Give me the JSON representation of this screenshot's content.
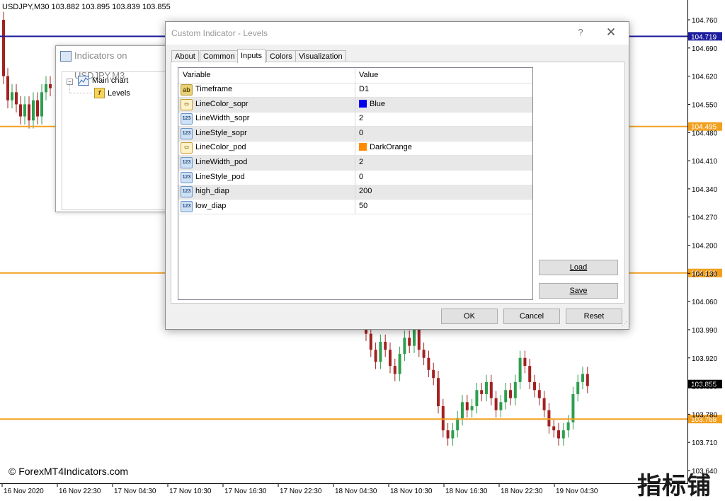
{
  "chart": {
    "header": "USDJPY,M30  103.882 103.895 103.839 103.855",
    "watermark": "© ForexMT4Indicators.com",
    "brand": "指标铺",
    "colors": {
      "bull": "#2e9e4f",
      "bear": "#a32121",
      "blue_line": "#1c1c9c",
      "orange_line": "#f2a020",
      "price_tag_bg": "#000000"
    },
    "price_axis": {
      "min": 103.64,
      "max": 104.76,
      "ticks": [
        "104.760",
        "104.690",
        "104.620",
        "104.550",
        "104.480",
        "104.410",
        "104.340",
        "104.270",
        "104.200",
        "104.130",
        "104.060",
        "103.990",
        "103.920",
        "103.850",
        "103.780",
        "103.710",
        "103.640"
      ]
    },
    "time_axis": [
      "16 Nov 2020",
      "16 Nov 22:30",
      "17 Nov 04:30",
      "17 Nov 10:30",
      "17 Nov 16:30",
      "17 Nov 22:30",
      "18 Nov 04:30",
      "18 Nov 10:30",
      "18 Nov 16:30",
      "18 Nov 22:30",
      "19 Nov 04:30"
    ],
    "levels": [
      {
        "name": "level-blue",
        "price": 104.719,
        "label": "104.719",
        "color": "#1c1c9c"
      },
      {
        "name": "level-orange-1",
        "price": 104.495,
        "label": "104.495",
        "color": "#f2a020"
      },
      {
        "name": "level-orange-2",
        "price": 104.131,
        "label": "104.131",
        "color": "#f2a020"
      },
      {
        "name": "level-orange-3",
        "price": 103.768,
        "label": "103.768",
        "color": "#f2a020"
      }
    ],
    "current_price": "103.855"
  },
  "indicators_window": {
    "title": "Indicators on USDJPY,M3",
    "tree": {
      "root": "Main chart",
      "child": "Levels"
    }
  },
  "dialog": {
    "title": "Custom Indicator - Levels",
    "help": "?",
    "close": "✕",
    "tabs": [
      "About",
      "Common",
      "Inputs",
      "Colors",
      "Visualization"
    ],
    "active_tab": "Inputs",
    "table": {
      "col_variable": "Variable",
      "col_value": "Value",
      "rows": [
        {
          "icon": "ab",
          "variable": "Timeframe",
          "value": "D1"
        },
        {
          "icon": "clr",
          "variable": "LineColor_sopr",
          "value": "Blue",
          "swatch": "#0000ee"
        },
        {
          "icon": "num",
          "variable": "LineWidth_sopr",
          "value": "2"
        },
        {
          "icon": "num",
          "variable": "LineStyle_sopr",
          "value": "0"
        },
        {
          "icon": "clr",
          "variable": "LineColor_pod",
          "value": "DarkOrange",
          "swatch": "#ff8c00"
        },
        {
          "icon": "num",
          "variable": "LineWidth_pod",
          "value": "2"
        },
        {
          "icon": "num",
          "variable": "LineStyle_pod",
          "value": "0"
        },
        {
          "icon": "num",
          "variable": "high_diap",
          "value": "200"
        },
        {
          "icon": "num",
          "variable": "low_diap",
          "value": "50"
        }
      ]
    },
    "buttons": {
      "load": "Load",
      "save": "Save",
      "ok": "OK",
      "cancel": "Cancel",
      "reset": "Reset"
    }
  }
}
